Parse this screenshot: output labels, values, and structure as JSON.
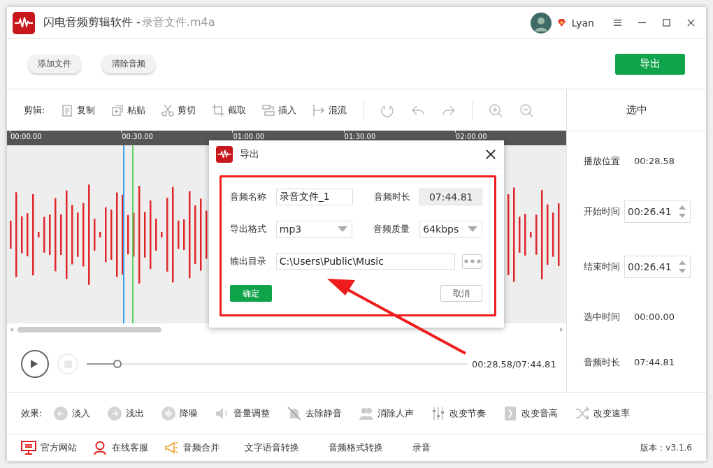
{
  "window": {
    "app_name": "闪电音频剪辑软件 - ",
    "file_name": "录音文件.m4a",
    "user": "Lyan"
  },
  "toolbar": {
    "buttons": [
      "添加文件",
      "清除音频"
    ],
    "export": "导出"
  },
  "edit_bar": {
    "label": "剪辑:",
    "tools": [
      {
        "kind": "copy",
        "label": "复制"
      },
      {
        "kind": "paste",
        "label": "粘贴"
      },
      {
        "kind": "cut",
        "label": "剪切"
      },
      {
        "kind": "crop",
        "label": "截取"
      },
      {
        "kind": "insert",
        "label": "插入"
      },
      {
        "kind": "mix",
        "label": "混流"
      }
    ]
  },
  "selection_header": "选中",
  "ruler": [
    "00:00.00",
    "00:30.00",
    "01:00.00",
    "01:30.00",
    "02:00.00"
  ],
  "info": [
    {
      "kind": "text",
      "label": "播放位置",
      "value": "00:28.58"
    },
    {
      "kind": "spinner",
      "label": "开始时间",
      "value": "00:26.41"
    },
    {
      "kind": "spinner",
      "label": "结束时间",
      "value": "00:26.41"
    },
    {
      "kind": "text",
      "label": "选中时间",
      "value": "00:00.00"
    },
    {
      "kind": "text",
      "label": "音频时长",
      "value": "07:44.81"
    }
  ],
  "player": {
    "level": 0.08,
    "time": "00:28.58/07:44.81"
  },
  "effects": {
    "label": "效果:",
    "items": [
      {
        "kind": "fadein",
        "label": "淡入"
      },
      {
        "kind": "fadeout",
        "label": "浅出"
      },
      {
        "kind": "denoise",
        "label": "降噪"
      },
      {
        "kind": "volume",
        "label": "音量调整"
      },
      {
        "kind": "mute",
        "label": "去除静音"
      },
      {
        "kind": "vocal",
        "label": "消除人声"
      },
      {
        "kind": "tempo",
        "label": "改变节奏"
      },
      {
        "kind": "pitch",
        "label": "改变音高"
      },
      {
        "kind": "speed",
        "label": "改变速率"
      }
    ]
  },
  "footer": {
    "links": [
      {
        "kind": "site",
        "label": "官方网站"
      },
      {
        "kind": "service",
        "label": "在线客服"
      },
      {
        "kind": "merge",
        "label": "音频合并"
      },
      {
        "kind": "plain",
        "label": "文字语音转换"
      },
      {
        "kind": "plain",
        "label": "音频格式转换"
      },
      {
        "kind": "plain",
        "label": "录音"
      }
    ],
    "version": "版本：v3.1.6"
  },
  "dialog": {
    "title": "导出",
    "name_label": "音频名称",
    "name": "录音文件_1",
    "duration_label": "音频时长",
    "duration": "07:44.81",
    "format_label": "导出格式",
    "format": "mp3",
    "quality_label": "音频质量",
    "quality": "64kbps",
    "dir_label": "输出目录",
    "dir": "C:\\Users\\Public\\Music",
    "ok": "确定",
    "cancel": "取消"
  }
}
